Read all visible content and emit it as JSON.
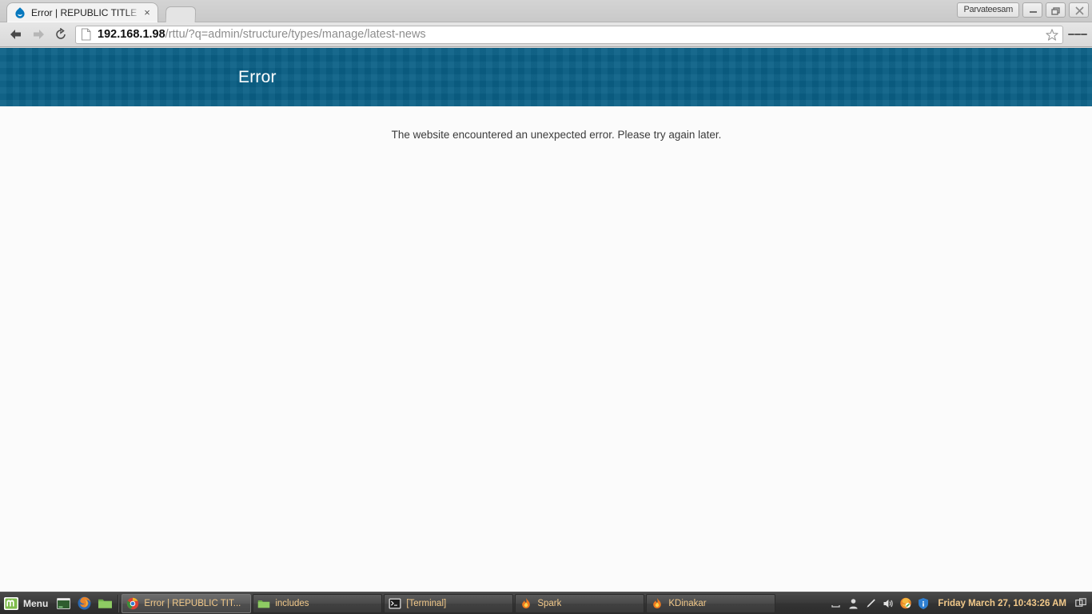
{
  "browser": {
    "tab": {
      "title": "Error | REPUBLIC TITLE",
      "favicon": "drupal-droplet-icon",
      "close_label": "×"
    },
    "newtab_label": "",
    "window_controls": {
      "user_label": "Parvateesam",
      "minimize_label": "",
      "maximize_label": "",
      "close_label": ""
    },
    "nav": {
      "back_icon": "back-arrow-icon",
      "forward_icon": "forward-arrow-icon",
      "reload_icon": "reload-icon"
    },
    "urlbar": {
      "page_icon": "page-document-icon",
      "host": "192.168.1.98",
      "path": "/rttu/?q=admin/structure/types/manage/latest-news",
      "full_url": "192.168.1.98/rttu/?q=admin/structure/types/manage/latest-news",
      "bookmark_icon": "star-outline-icon"
    },
    "menu_icon": "hamburger-menu-icon"
  },
  "page": {
    "header_title": "Error",
    "header_color": "#0a6086",
    "body_color": "#fbfbfb",
    "message": "The website encountered an unexpected error. Please try again later."
  },
  "taskbar": {
    "menu": {
      "label": "Menu",
      "icon": "linux-mint-logo-icon"
    },
    "launchers": [
      {
        "name": "terminal-launcher",
        "icon": "terminal-icon"
      },
      {
        "name": "firefox-launcher",
        "icon": "firefox-icon"
      },
      {
        "name": "files-launcher",
        "icon": "folder-icon"
      }
    ],
    "windows": [
      {
        "label": "Error | REPUBLIC TIT...",
        "icon": "chrome-icon",
        "active": true
      },
      {
        "label": "includes",
        "icon": "folder-icon",
        "active": false
      },
      {
        "label": "[Terminal]",
        "icon": "terminal-icon",
        "active": false
      },
      {
        "label": "Spark",
        "icon": "flame-icon",
        "active": false
      },
      {
        "label": "KDinakar",
        "icon": "flame-icon",
        "active": false
      }
    ],
    "tray": [
      {
        "name": "hide-panel-icon"
      },
      {
        "name": "user-icon"
      },
      {
        "name": "pen-icon"
      },
      {
        "name": "volume-icon"
      },
      {
        "name": "firefox-tray-icon"
      },
      {
        "name": "update-shield-icon"
      }
    ],
    "clock": "Friday March 27, 10:43:26 AM",
    "workspace_icon": "workspace-switcher-icon"
  }
}
